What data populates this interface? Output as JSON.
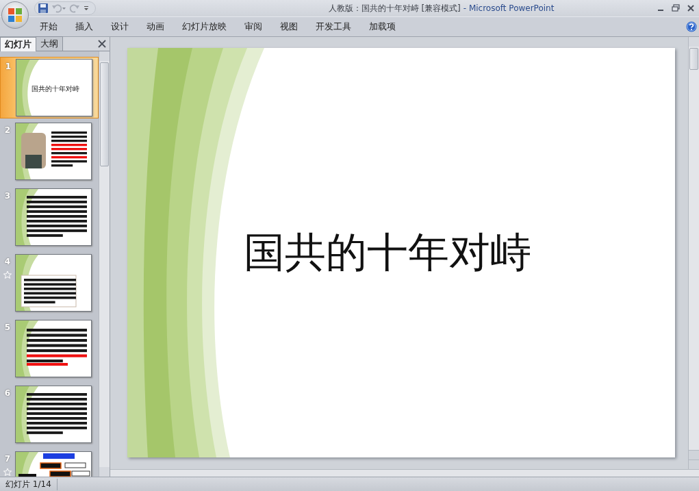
{
  "window": {
    "title": "人教版：国共的十年对峙 [兼容模式]",
    "app_name": "- Microsoft PowerPoint"
  },
  "ribbon_tabs": [
    {
      "label": "开始"
    },
    {
      "label": "插入"
    },
    {
      "label": "设计"
    },
    {
      "label": "动画"
    },
    {
      "label": "幻灯片放映"
    },
    {
      "label": "审阅"
    },
    {
      "label": "视图"
    },
    {
      "label": "开发工具"
    },
    {
      "label": "加载项"
    }
  ],
  "pane_tabs": [
    {
      "label": "幻灯片",
      "selected": true
    },
    {
      "label": "大纲",
      "selected": false
    }
  ],
  "thumbnails": [
    {
      "number": "1",
      "selected": true,
      "animated": false,
      "kind": "title",
      "title": "国共的十年对峙"
    },
    {
      "number": "2",
      "selected": false,
      "animated": false,
      "kind": "photo_text"
    },
    {
      "number": "3",
      "selected": false,
      "animated": false,
      "kind": "text"
    },
    {
      "number": "4",
      "selected": false,
      "animated": true,
      "kind": "boxed_text"
    },
    {
      "number": "5",
      "selected": false,
      "animated": false,
      "kind": "red_text"
    },
    {
      "number": "6",
      "selected": false,
      "animated": false,
      "kind": "text"
    },
    {
      "number": "7",
      "selected": false,
      "animated": true,
      "kind": "diagram"
    }
  ],
  "slide": {
    "title": "国共的十年对峙"
  },
  "status_bar": {
    "slide_counter": "幻灯片 1/14"
  }
}
